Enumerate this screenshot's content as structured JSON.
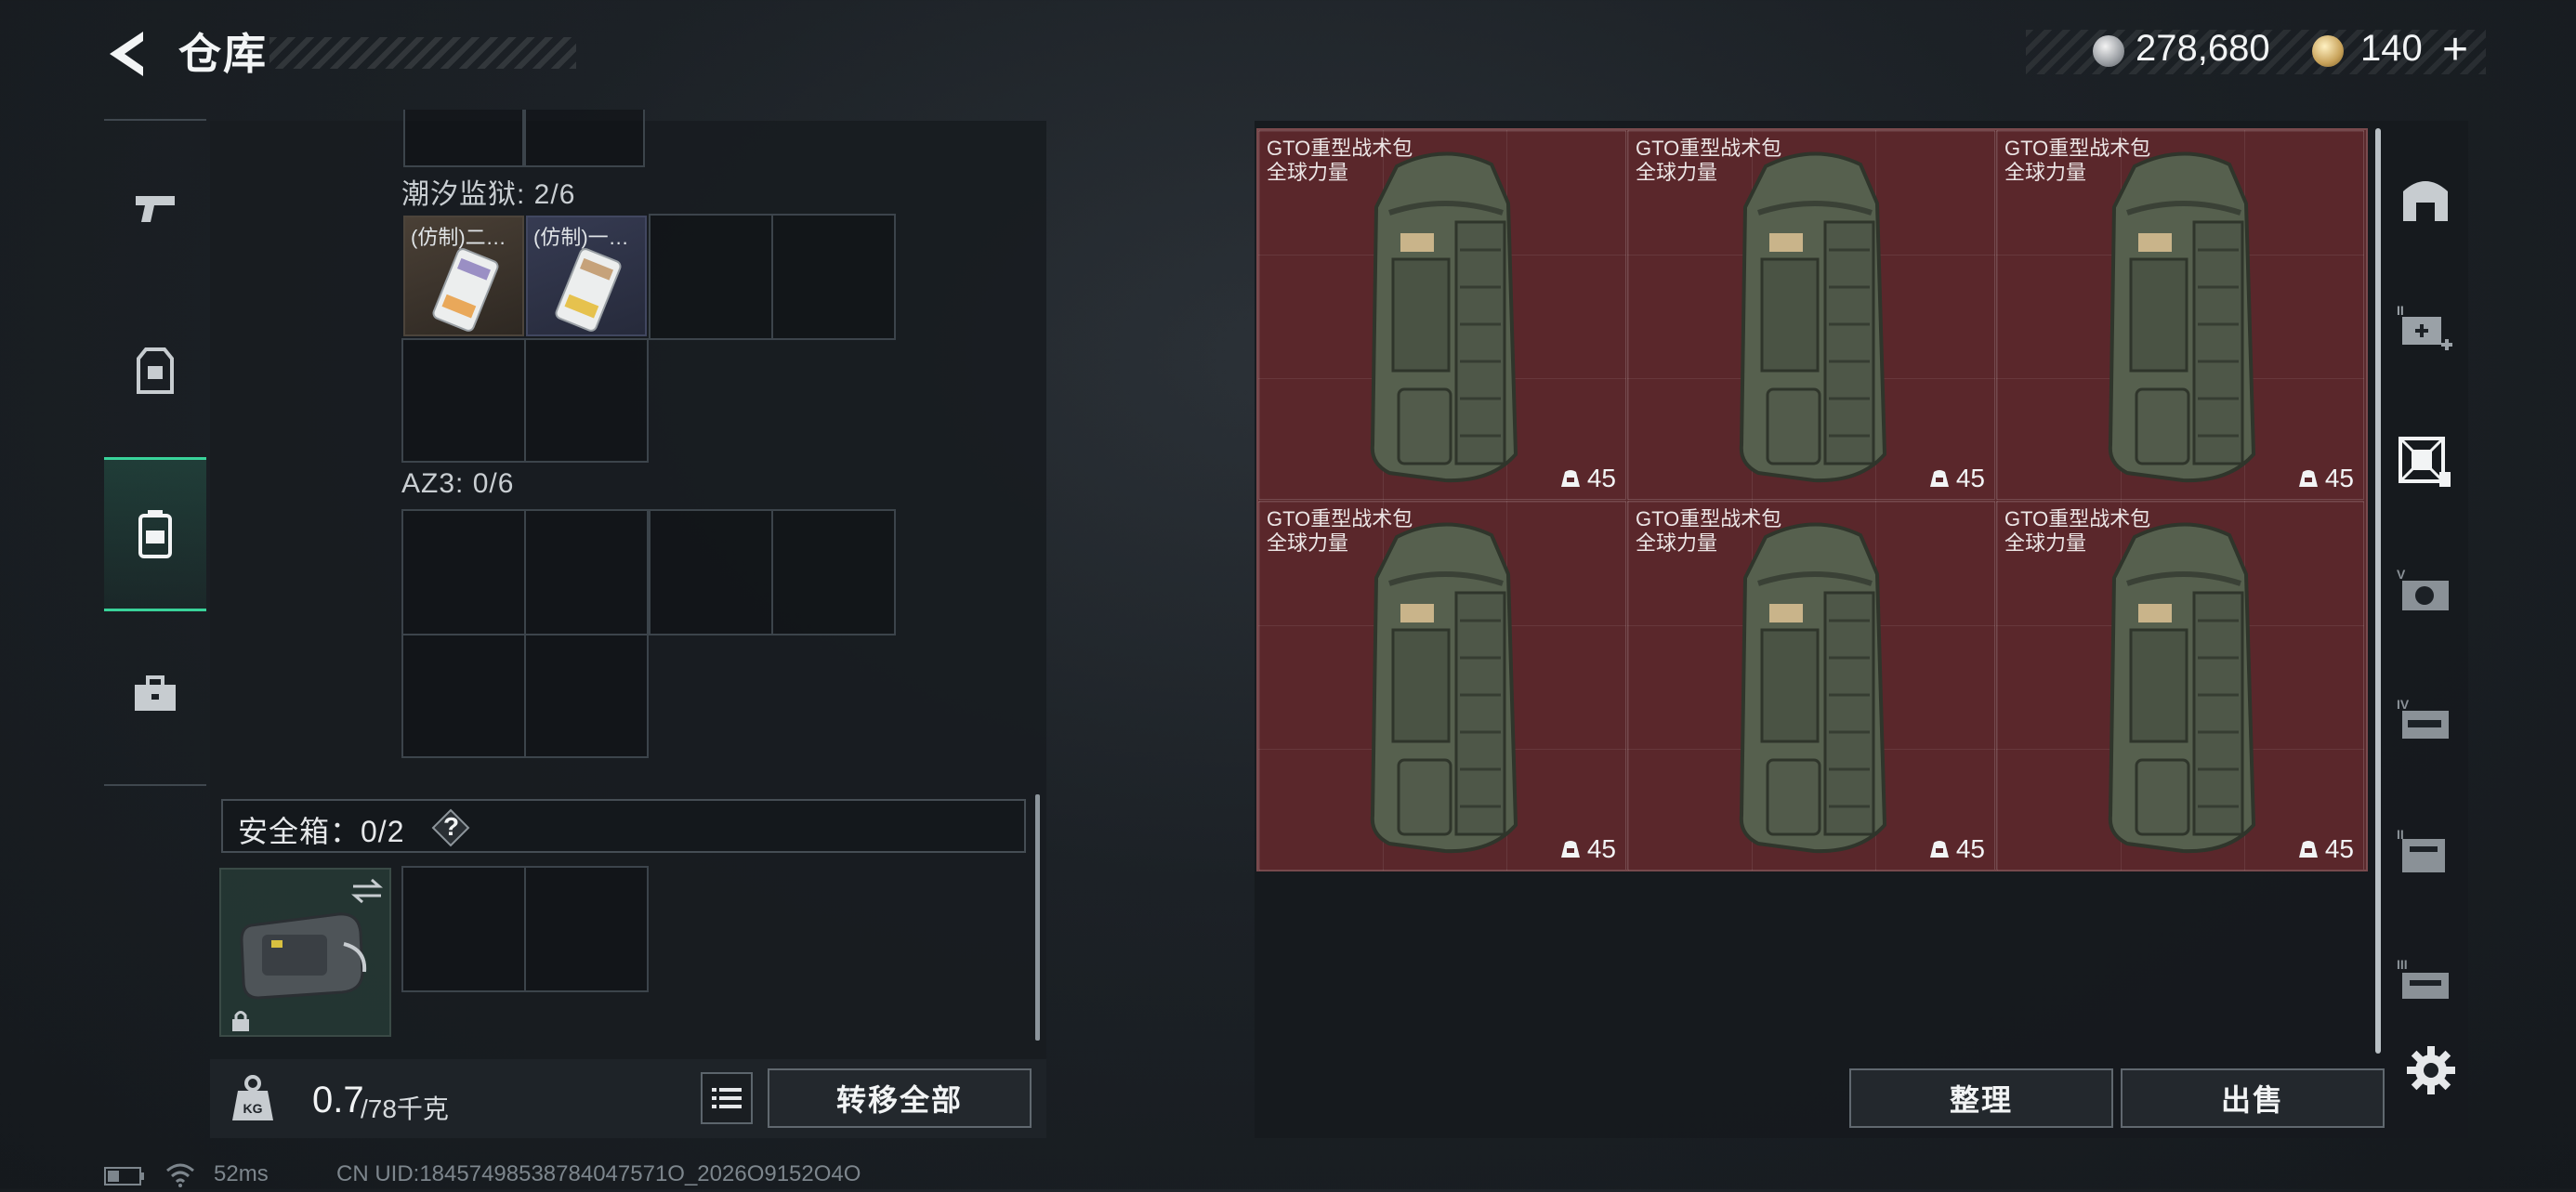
{
  "header": {
    "title": "仓库",
    "back_icon": "back-arrow-icon"
  },
  "currency": {
    "silver": {
      "icon": "silver-coin-icon",
      "value": "278,680"
    },
    "gold": {
      "icon": "gold-coin-icon",
      "value": "140",
      "add_label": "+"
    }
  },
  "left_tabs": [
    {
      "icon": "pistol-icon",
      "active": false
    },
    {
      "icon": "armor-vest-icon",
      "active": false
    },
    {
      "icon": "backpack-icon",
      "active": true
    },
    {
      "icon": "toolbox-icon",
      "active": false
    }
  ],
  "containers": {
    "tide_prison": {
      "label": "潮汐监狱: 2/6",
      "items": [
        {
          "name": "(仿制)二…",
          "icon": "keycard-icon"
        },
        {
          "name": "(仿制)一…",
          "icon": "keycard-icon"
        }
      ]
    },
    "az3": {
      "label": "AZ3: 0/6"
    }
  },
  "safebox": {
    "label": "安全箱：0/2",
    "help": "?",
    "icons": [
      "safebox-case-icon",
      "swap-icon",
      "lock-icon"
    ]
  },
  "weight": {
    "value": "0.7",
    "capacity": "/78千克",
    "icon": "kg-weight-icon"
  },
  "buttons": {
    "transfer_all": "转移全部",
    "sort": "整理",
    "sell": "出售"
  },
  "storage": {
    "items": [
      {
        "name": "GTO重型战术包",
        "sub": "全球力量",
        "count": "45"
      },
      {
        "name": "GTO重型战术包",
        "sub": "全球力量",
        "count": "45"
      },
      {
        "name": "GTO重型战术包",
        "sub": "全球力量",
        "count": "45"
      },
      {
        "name": "GTO重型战术包",
        "sub": "全球力量",
        "count": "45"
      },
      {
        "name": "GTO重型战术包",
        "sub": "全球力量",
        "count": "45"
      },
      {
        "name": "GTO重型战术包",
        "sub": "全球力量",
        "count": "45"
      }
    ],
    "colors": {
      "item_bg": "#5a272b",
      "grid_line": "#7a4a4d"
    }
  },
  "side_tabs": [
    {
      "icon": "home-stash-icon"
    },
    {
      "icon": "stash-2-add-icon",
      "roman": "II"
    },
    {
      "icon": "stash-active-icon",
      "active": true
    },
    {
      "icon": "stash-5-icon",
      "roman": "V"
    },
    {
      "icon": "stash-4-icon",
      "roman": "IV"
    },
    {
      "icon": "stash-3-icon",
      "roman": "II"
    },
    {
      "icon": "stash-1-icon",
      "roman": "III"
    }
  ],
  "status": {
    "ping": "52ms",
    "uid": "CN UID:18457498538784047571O_2026O9152O4O"
  },
  "accent": {
    "active_tab": "#39d39a"
  }
}
